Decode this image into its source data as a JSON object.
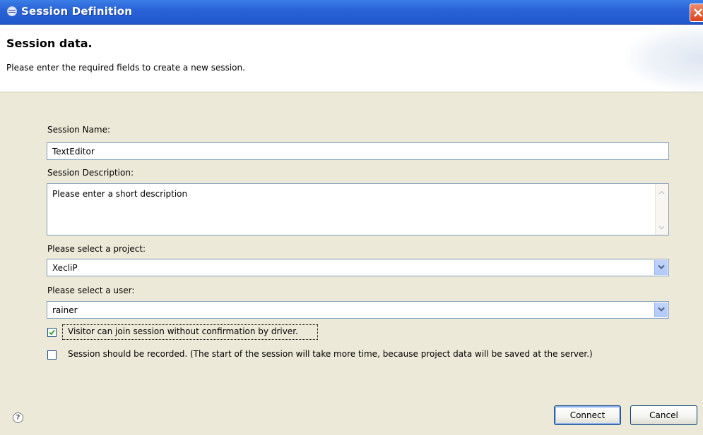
{
  "window": {
    "title": "Session Definition"
  },
  "header": {
    "title": "Session data.",
    "subtitle": "Please enter the required fields to create a new session."
  },
  "form": {
    "session_name_label": "Session Name:",
    "session_name_value": "TextEditor",
    "session_description_label": "Session Description:",
    "session_description_value": "Please enter a short description",
    "project_label": "Please select a project:",
    "project_value": "XecliP",
    "user_label": "Please select a user:",
    "user_value": "rainer",
    "visitor_checkbox_label": "Visitor can join session without confirmation by driver.",
    "visitor_checked": true,
    "record_checkbox_label": "Session should be recorded. (The start of the session will take more time, because project data will be saved at the server.)",
    "record_checked": false
  },
  "buttons": {
    "connect": "Connect",
    "cancel": "Cancel"
  },
  "icons": {
    "window": "eclipse-icon",
    "close": "close-icon",
    "help": "help-icon",
    "dropdown": "chevron-down-icon"
  },
  "colors": {
    "titlebar": "#2a63d8",
    "dialog_background": "#ece9d8",
    "field_border": "#7f9db9"
  }
}
